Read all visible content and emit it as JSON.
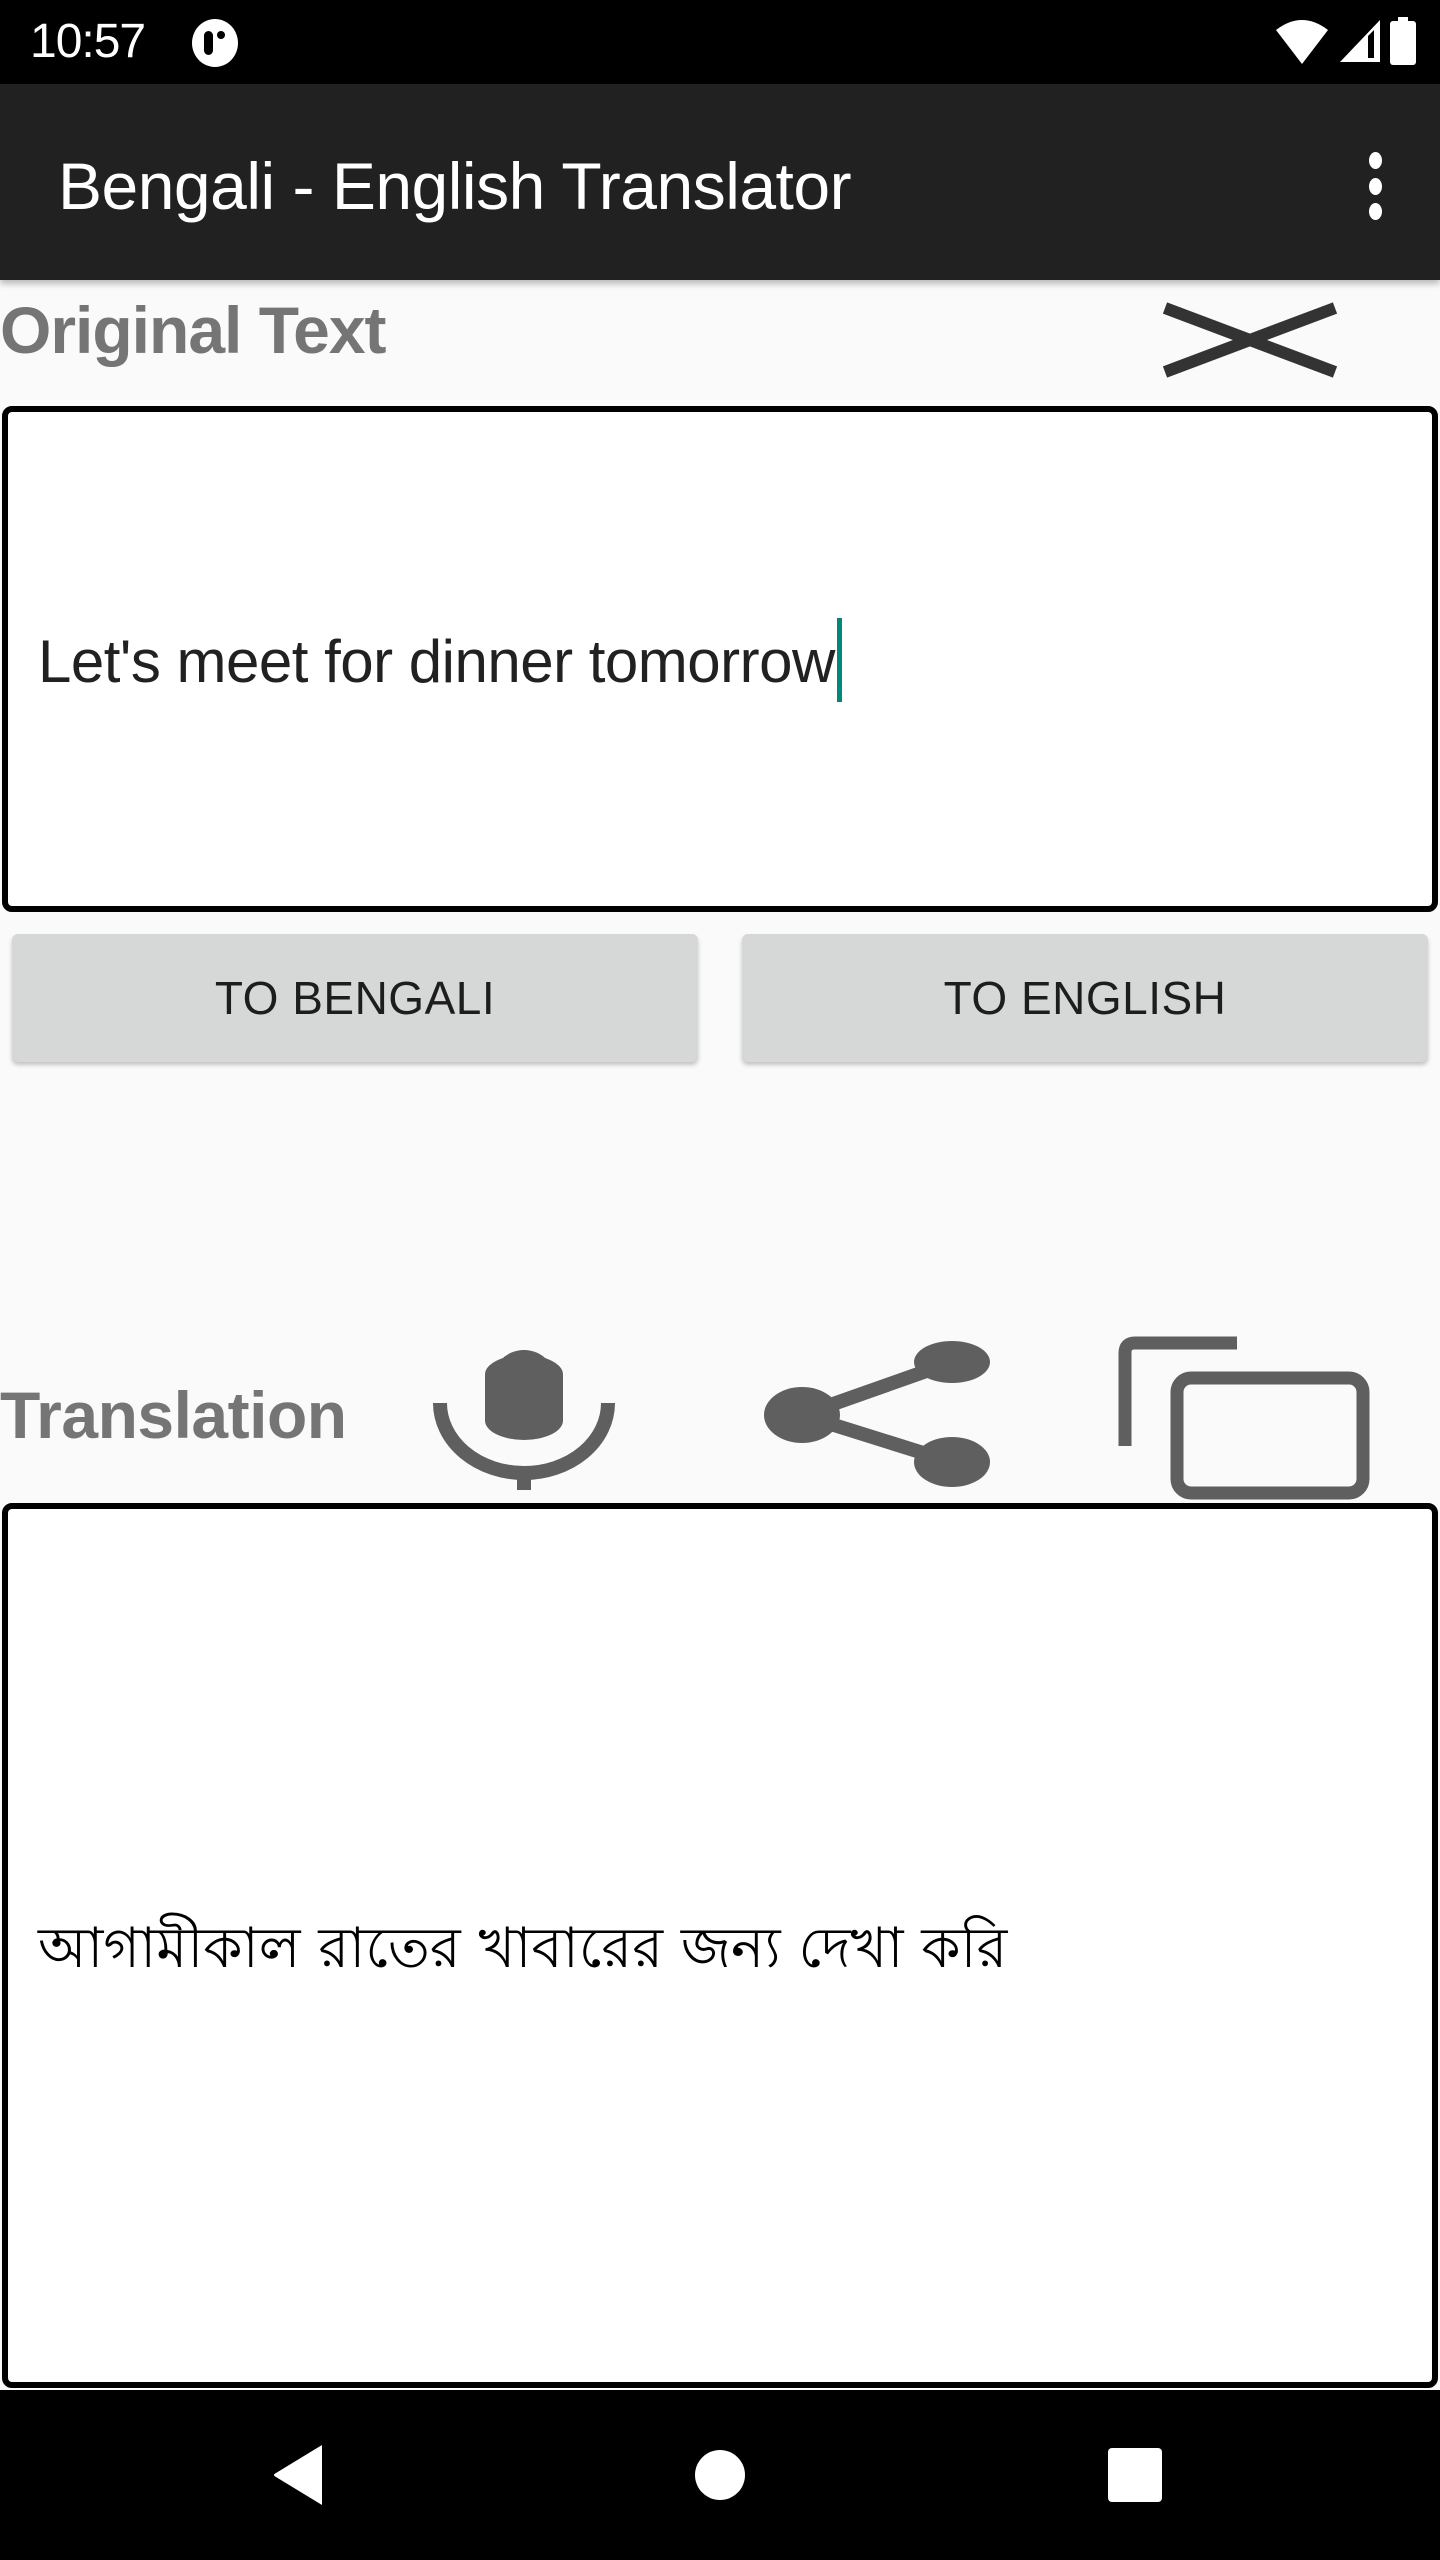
{
  "status_bar": {
    "time": "10:57",
    "icons": [
      "app-notification-icon",
      "wifi-icon",
      "cell-signal-icon",
      "battery-icon"
    ]
  },
  "app_bar": {
    "title": "Bengali - English Translator",
    "overflow_icon": "more-vert-icon"
  },
  "original": {
    "label": "Original Text",
    "clear_icon": "close-icon",
    "input_value": "Let's meet for dinner tomorrow",
    "cursor_color": "#00897b"
  },
  "actions": {
    "to_bengali": "TO BENGALI",
    "to_english": "TO ENGLISH"
  },
  "translation": {
    "label": "Translation",
    "icons": [
      "mic-icon",
      "share-icon",
      "copy-icon"
    ],
    "output_value": "আগামীকাল রাতের খাবারের জন্য দেখা করি"
  },
  "nav_bar": {
    "icons": [
      "back-icon",
      "home-icon",
      "recents-icon"
    ]
  },
  "colors": {
    "app_bar": "#212121",
    "label_gray": "#757575",
    "icon_gray": "#5f5f5f",
    "button_bg": "#d6d7d7",
    "background": "#fafafa"
  }
}
